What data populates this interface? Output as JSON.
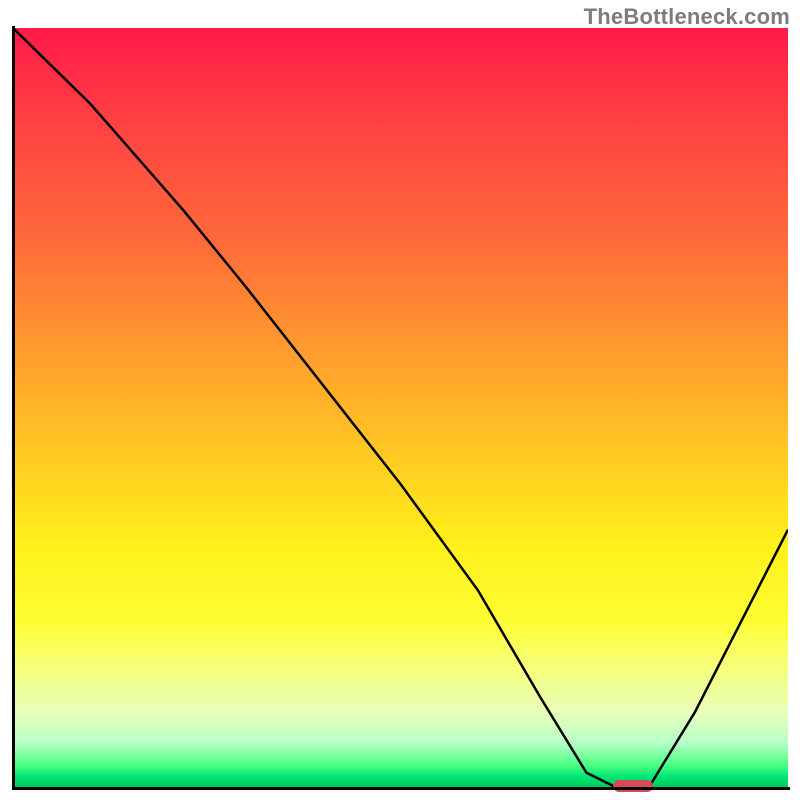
{
  "watermark": "TheBottleneck.com",
  "colors": {
    "gradient_top": "#ff1a49",
    "gradient_mid": "#ffd11a",
    "gradient_bottom": "#00c853",
    "curve": "#000000",
    "axis": "#000000",
    "marker": "#d44a56",
    "watermark_text": "#7c7c7c"
  },
  "chart_data": {
    "type": "line",
    "title": "",
    "xlabel": "",
    "ylabel": "",
    "xlim": [
      0,
      100
    ],
    "ylim": [
      0,
      100
    ],
    "series": [
      {
        "name": "bottleneck-curve",
        "x": [
          0,
          10,
          22,
          30,
          40,
          50,
          60,
          68,
          74,
          78,
          82,
          88,
          94,
          100
        ],
        "y": [
          100,
          90,
          76,
          66,
          53,
          40,
          26,
          12,
          2,
          0,
          0,
          10,
          22,
          34
        ]
      }
    ],
    "annotations": [
      {
        "name": "minimum-marker",
        "x": 80,
        "y": 0
      }
    ]
  }
}
